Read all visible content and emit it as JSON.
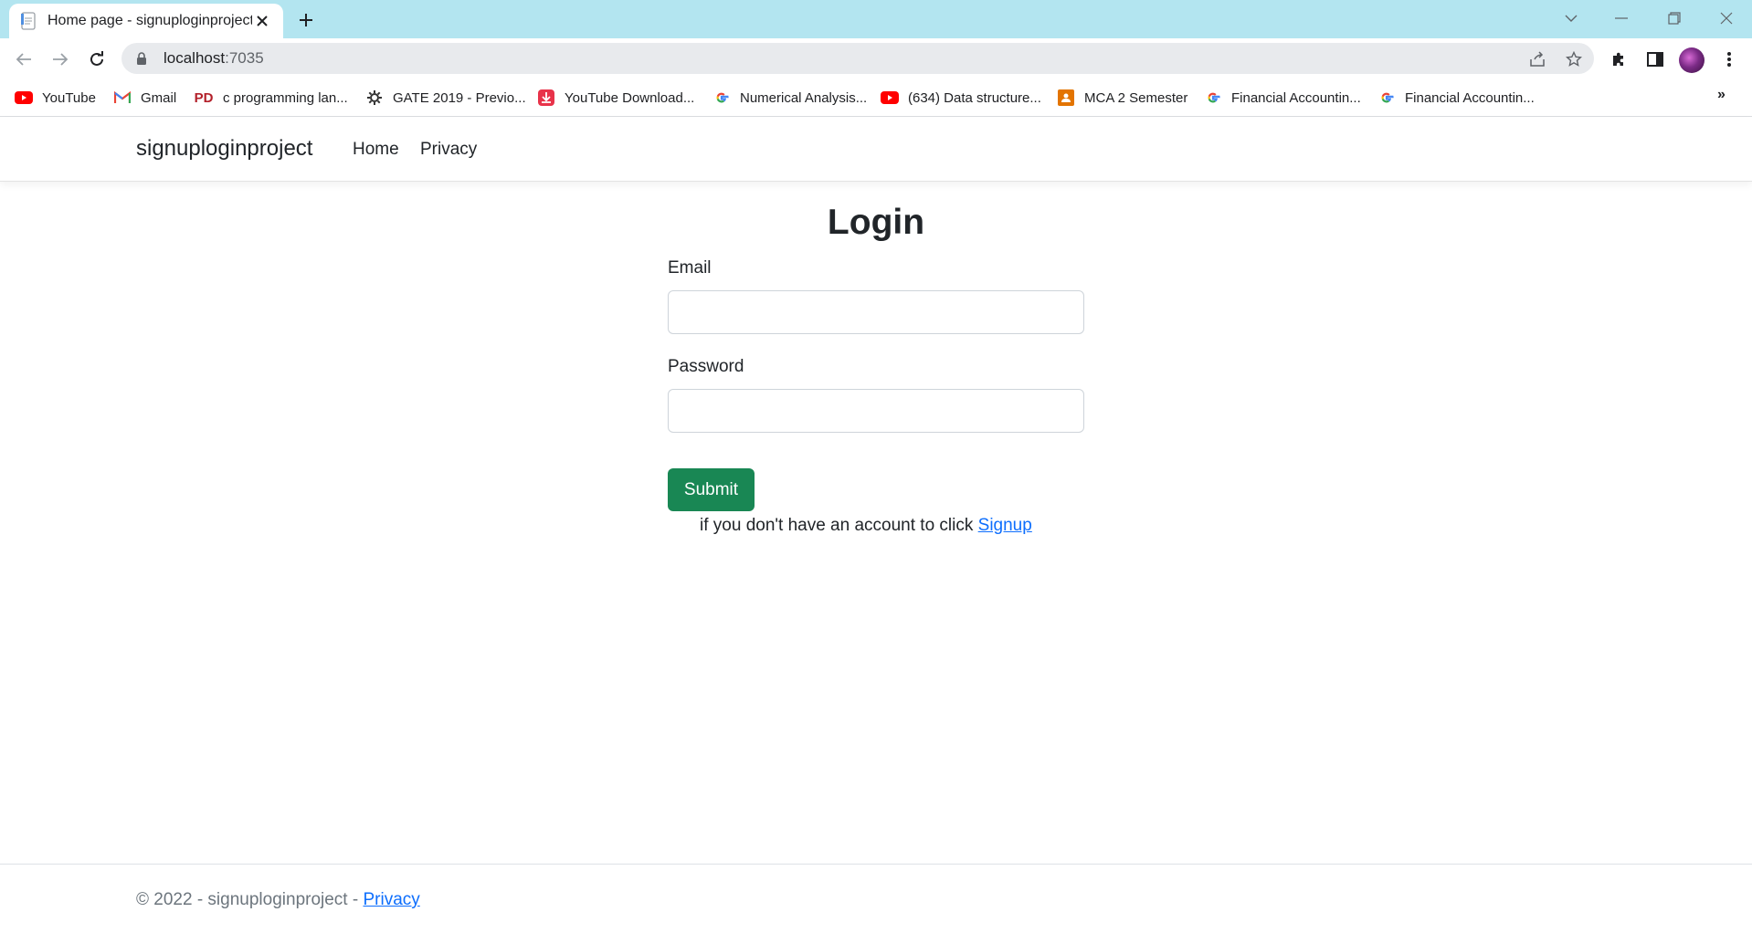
{
  "browser": {
    "tab_title": "Home page - signuploginproject",
    "url_host": "localhost",
    "url_port": ":7035",
    "bookmarks": [
      {
        "label": "YouTube",
        "icon": "youtube-icon"
      },
      {
        "label": "Gmail",
        "icon": "gmail-icon"
      },
      {
        "label": "c programming lan...",
        "icon": "pd-icon"
      },
      {
        "label": "GATE 2019 - Previo...",
        "icon": "gear-logo-icon"
      },
      {
        "label": "YouTube Download...",
        "icon": "download-icon"
      },
      {
        "label": "Numerical Analysis...",
        "icon": "google-icon"
      },
      {
        "label": "(634) Data structure...",
        "icon": "youtube-icon"
      },
      {
        "label": "MCA 2 Semester",
        "icon": "classroom-icon"
      },
      {
        "label": "Financial Accountin...",
        "icon": "google-icon"
      },
      {
        "label": "Financial Accountin...",
        "icon": "google-icon"
      }
    ],
    "more_bookmarks": "»"
  },
  "site": {
    "brand": "signuploginproject",
    "nav": [
      "Home",
      "Privacy"
    ]
  },
  "login": {
    "title": "Login",
    "email_label": "Email",
    "email_value": "",
    "password_label": "Password",
    "password_value": "",
    "submit_label": "Submit",
    "signup_prefix": "if you don't have an account to click",
    "signup_link": "Signup"
  },
  "footer": {
    "text": "© 2022 - signuploginproject - ",
    "privacy_link": "Privacy"
  },
  "colors": {
    "tabstrip": "#b3e5f0",
    "submit": "#198754",
    "link": "#0d6efd"
  }
}
